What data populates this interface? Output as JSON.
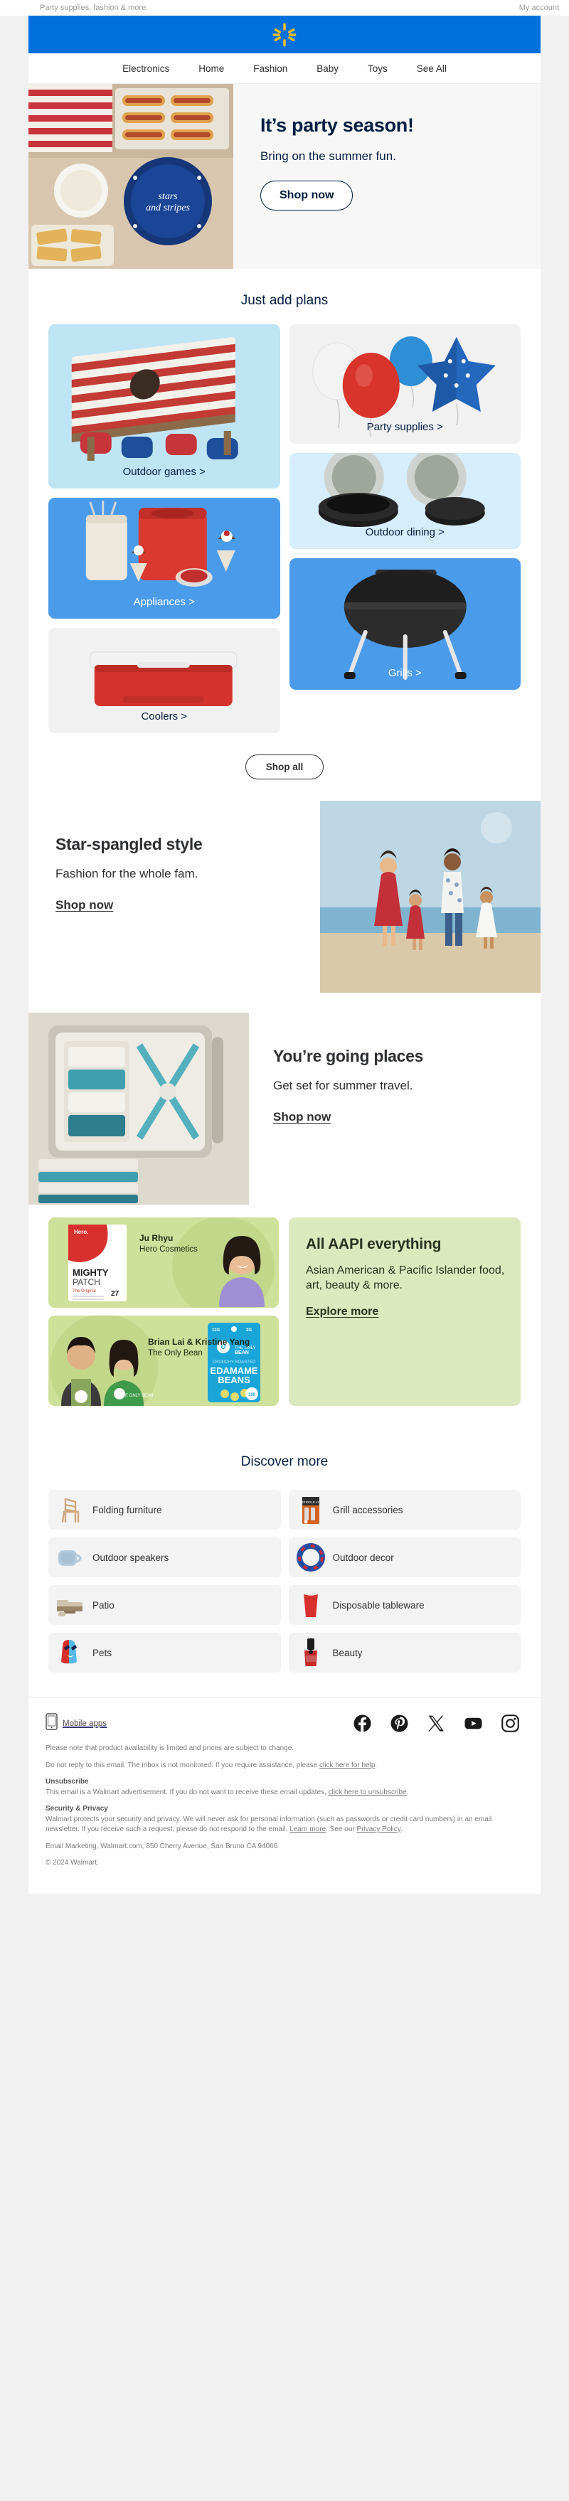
{
  "preheader": {
    "text": "Party supplies, fashion & more.",
    "account_link": "My account"
  },
  "brand": {
    "logo_name": "walmart-spark-logo",
    "blue": "#0071dc",
    "yellow": "#ffc220",
    "navy": "#041e42"
  },
  "nav": {
    "items": [
      {
        "label": "Electronics"
      },
      {
        "label": "Home"
      },
      {
        "label": "Fashion"
      },
      {
        "label": "Baby"
      },
      {
        "label": "Toys"
      },
      {
        "label": "See All"
      }
    ]
  },
  "hero": {
    "headline": "It’s party season!",
    "subhead": "Bring on the summer fun.",
    "cta": "Shop now"
  },
  "just_add_plans": {
    "title": "Just add plans",
    "tiles": [
      {
        "label": "Outdoor games >",
        "bg": "#bfe5f5",
        "text": "dark"
      },
      {
        "label": "Party supplies >",
        "bg": "#f1f1f1",
        "text": "dark"
      },
      {
        "label": "Appliances >",
        "bg": "#4a9bea",
        "text": "white"
      },
      {
        "label": "Outdoor dining >",
        "bg": "#d6eefb",
        "text": "dark"
      },
      {
        "label": "Coolers >",
        "bg": "#f1f1f1",
        "text": "dark"
      },
      {
        "label": "Grills >",
        "bg": "#4a9bea",
        "text": "white"
      }
    ],
    "shop_all": "Shop all"
  },
  "promos": [
    {
      "headline": "Star-spangled style",
      "body": "Fashion for the whole fam.",
      "link": "Shop now",
      "image_name": "family-beach-photo"
    },
    {
      "headline": "You’re going places",
      "body": "Get set for summer travel.",
      "link": "Shop now",
      "image_name": "packed-suitcase-photo"
    }
  ],
  "aapi": {
    "headline": "All AAPI everything",
    "body": "Asian American & Pacific Islander food, art, beauty & more.",
    "link": "Explore more",
    "bg": "#dce8bd",
    "cards": [
      {
        "name": "Ju Rhyu",
        "brand": "Hero Cosmetics",
        "product": "MIGHTY PATCH",
        "product_sub": "The Original",
        "product_count": "27",
        "product_brand": "Hero."
      },
      {
        "name": "Brian Lai & Kristine Yang",
        "brand": "The Only Bean",
        "product": "EDAMAME BEANS",
        "product_sub": "CRUNCHY ROASTED",
        "product_brand": "THE ONLY BEAN"
      }
    ]
  },
  "discover": {
    "title": "Discover more",
    "items": [
      {
        "label": "Folding furniture",
        "icon": "folding-chair-thumb"
      },
      {
        "label": "Grill accessories",
        "icon": "griddle-kit-thumb"
      },
      {
        "label": "Outdoor speakers",
        "icon": "bluetooth-speaker-thumb"
      },
      {
        "label": "Outdoor decor",
        "icon": "patriotic-wreath-thumb"
      },
      {
        "label": "Patio",
        "icon": "patio-sectional-thumb"
      },
      {
        "label": "Disposable tableware",
        "icon": "red-cup-thumb"
      },
      {
        "label": "Pets",
        "icon": "pet-toy-thumb"
      },
      {
        "label": "Beauty",
        "icon": "nail-polish-thumb"
      }
    ]
  },
  "footer": {
    "mobile_apps": "Mobile apps",
    "socials": [
      {
        "name": "facebook-icon"
      },
      {
        "name": "pinterest-icon"
      },
      {
        "name": "x-twitter-icon"
      },
      {
        "name": "youtube-icon"
      },
      {
        "name": "instagram-icon"
      }
    ],
    "availability_note": "Please note that product availability is limited and prices are subject to change.",
    "noreply_prefix": "Do not reply to this email. The inbox is not monitored. If you require assistance, please ",
    "noreply_link": "click here for help",
    "noreply_suffix": ".",
    "unsubscribe_heading": "Unsubscribe",
    "unsubscribe_prefix": "This email is a Walmart advertisement. If you do not want to receive these email updates, ",
    "unsubscribe_link": "click here to unsubscribe",
    "unsubscribe_suffix": ".",
    "privacy_heading": "Security & Privacy",
    "privacy_body_prefix": "Walmart protects your security and privacy. We will never ask for personal information (such as passwords or credit card numbers) in an email newsletter. If you receive such a request, please do not respond to the email. ",
    "privacy_link1": "Learn more",
    "privacy_mid": ". See our ",
    "privacy_link2": "Privacy Policy",
    "privacy_suffix": ".",
    "address": "Email Marketing, Walmart.com, 850 Cherry Avenue, San Bruno CA 94066",
    "copyright": "© 2024 Walmart."
  }
}
